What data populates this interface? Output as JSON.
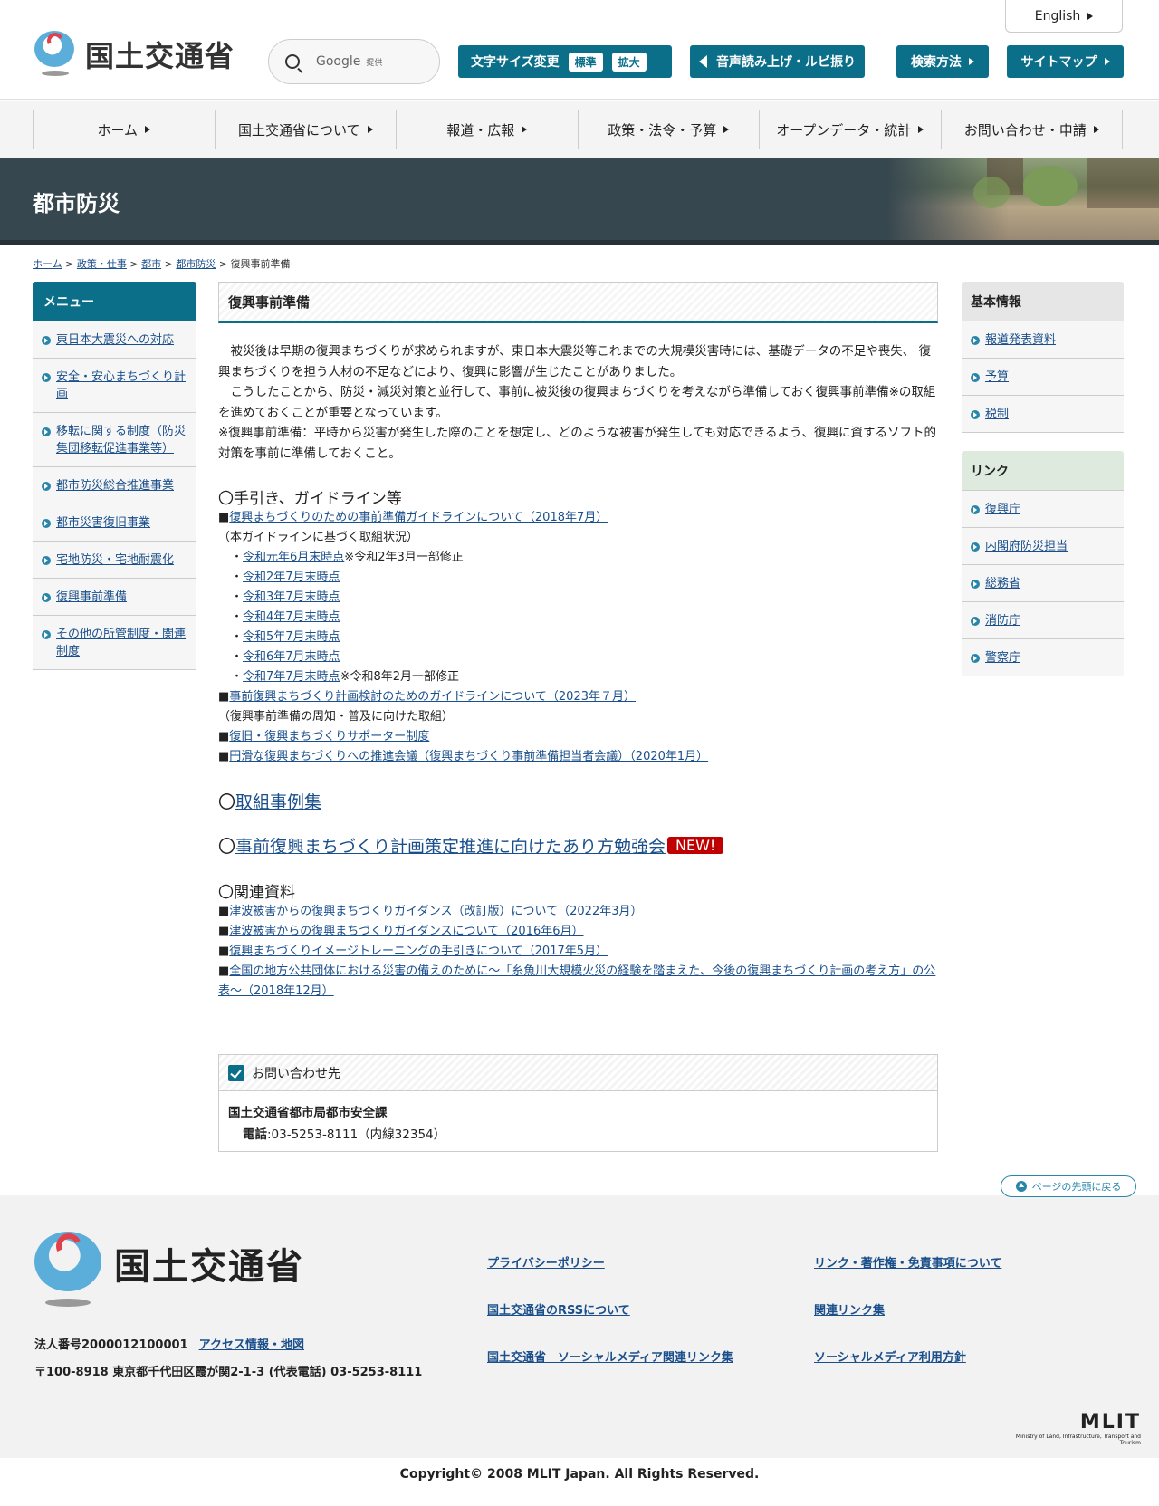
{
  "header": {
    "logo_text": "国土交通省",
    "search_label": "Google",
    "search_provider": "提供",
    "english": "English",
    "font_size_label": "文字サイズ変更",
    "font_standard": "標準",
    "font_large": "拡大",
    "voice_label": "音声読み上げ・ルビ振り",
    "search_method": "検索方法",
    "sitemap": "サイトマップ"
  },
  "nav": [
    "ホーム",
    "国土交通省について",
    "報道・広報",
    "政策・法令・予算",
    "オープンデータ・統計",
    "お問い合わせ・申請"
  ],
  "banner_title": "都市防災",
  "breadcrumb": {
    "home": "ホーム",
    "policy": "政策・仕事",
    "city": "都市",
    "disaster": "都市防災",
    "current": "復興事前準備",
    "sep": ">"
  },
  "left_menu": {
    "title": "メニュー",
    "items": [
      "東日本大震災への対応",
      "安全・安心まちづくり計画",
      "移転に関する制度（防災集団移転促進事業等）",
      "都市防災総合推進事業",
      "都市災害復旧事業",
      "宅地防災・宅地耐震化",
      "復興事前準備",
      "その他の所管制度・関連制度"
    ]
  },
  "main": {
    "title": "復興事前準備",
    "intro": [
      "　被災後は早期の復興まちづくりが求められますが、東日本大震災等これまでの大規模災害時には、基礎データの不足や喪失、 復興まちづくりを担う人材の不足などにより、復興に影響が生じたことがありました。",
      "　こうしたことから、防災・減災対策と並行して、事前に被災後の復興まちづくりを考えながら準備しておく復興事前準備※の取組を進めておくことが重要となっています。",
      " ※復興事前準備：平時から災害が発生した際のことを想定し、どのような被害が発生しても対応できるよう、復興に資するソフト的対策を事前に準備しておくこと。"
    ],
    "section1_title": "〇手引き、ガイドライン等",
    "guideline_link": "復興まちづくりのための事前準備ガイドラインについて（2018年7月）",
    "guideline_note": "（本ガイドラインに基づく取組状況）",
    "status": [
      {
        "link": "令和元年6月末時点",
        "note": "※令和2年3月一部修正"
      },
      {
        "link": "令和2年7月末時点",
        "note": ""
      },
      {
        "link": "令和3年7月末時点",
        "note": ""
      },
      {
        "link": "令和4年7月末時点",
        "note": ""
      },
      {
        "link": "令和5年7月末時点",
        "note": ""
      },
      {
        "link": "令和6年7月末時点",
        "note": ""
      },
      {
        "link": "令和7年7月末時点",
        "note": "※令和8年2月一部修正"
      }
    ],
    "plan_guideline_link": "事前復興まちづくり計画検討のためのガイドラインについて（2023年７月）",
    "promo_note": "（復興事前準備の周知・普及に向けた取組）",
    "supporter_link": "復旧・復興まちづくりサポーター制度",
    "meeting_link": "円滑な復興まちづくりへの推進会議（復興まちづくり事前準備担当者会議）（2020年1月）",
    "cases_prefix": "〇",
    "cases_link": "取組事例集",
    "study_prefix": "〇",
    "study_link": "事前復興まちづくり計画策定推進に向けたあり方勉強会",
    "new_badge": "NEW!",
    "section2_title": "〇関連資料",
    "related": [
      "津波被害からの復興まちづくりガイダンス（改訂版）について（2022年3月）",
      "津波被害からの復興まちづくりガイダンスについて（2016年6月）",
      "復興まちづくりイメージトレーニングの手引きについて（2017年5月）",
      "全国の地方公共団体における災害の備えのために～「糸魚川大規模火災の経験を踏まえた、今後の復興まちづくり計画の考え方」の公表～（2018年12月）"
    ],
    "bullet": "■",
    "dot": "・"
  },
  "contact": {
    "title": "お問い合わせ先",
    "org": "国土交通省都市局都市安全課",
    "tel_label": "電話",
    "tel": ":03-5253-8111（内線32354）"
  },
  "right": {
    "basic_title": "基本情報",
    "basic_items": [
      "報道発表資料",
      "予算",
      "税制"
    ],
    "link_title": "リンク",
    "link_items": [
      "復興庁",
      "内閣府防災担当",
      "総務省",
      "消防庁",
      "警察庁"
    ]
  },
  "page_top": "ページの先頭に戻る",
  "footer": {
    "logo_text": "国土交通省",
    "corp_number": "法人番号2000012100001",
    "access": "アクセス情報・地図",
    "address": "〒100-8918 東京都千代田区霞が関2-1-3 (代表電話) 03-5253-8111",
    "links": {
      "privacy": "プライバシーポリシー",
      "copyright_links": "リンク・著作権・免責事項について",
      "rss": "国土交通省のRSSについて",
      "related": "関連リンク集",
      "social": "国土交通省　ソーシャルメディア関連リンク集",
      "social_policy": "ソーシャルメディア利用方針"
    },
    "mlit": "MLIT",
    "mlit_sub": "Ministry of Land, Infrastructure, Transport and Tourism",
    "copyright": "Copyright© 2008 MLIT Japan. All Rights Reserved."
  },
  "colors": {
    "accent": "#0b6f8a",
    "link": "#1a4f8b",
    "new": "#c00000",
    "banner": "#37474f"
  }
}
